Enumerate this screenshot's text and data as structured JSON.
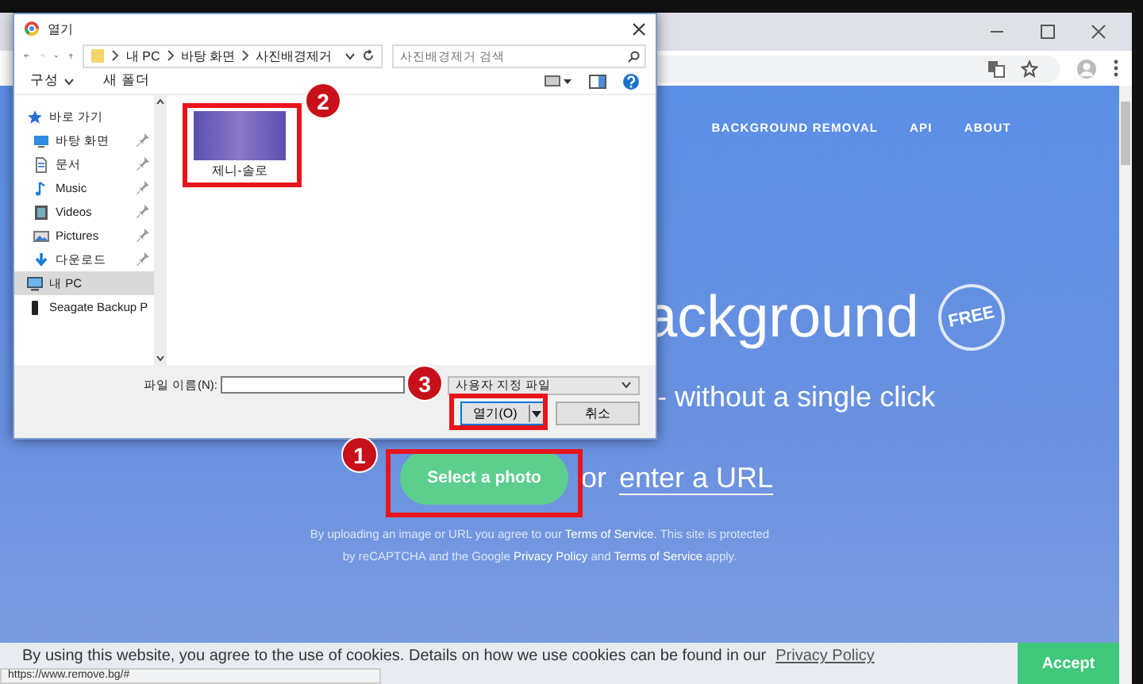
{
  "browser": {
    "nav": [
      "BACKGROUND REMOVAL",
      "API",
      "ABOUT"
    ],
    "headline": "ackground",
    "free_badge": "FREE",
    "subtitle": "- without a single click",
    "select_button": "Select a photo",
    "or_text": "or",
    "url_link": "enter a URL",
    "legal": [
      "By uploading an image or URL you agree to our **Terms of Service**. This site is protected",
      "by reCAPTCHA and the Google **Privacy Policy** and **Terms of Service** apply."
    ],
    "cookie": {
      "text": "By using this website, you agree to the use of cookies. Details on how we use cookies can be found in our",
      "link": "Privacy Policy",
      "button": "Accept"
    },
    "status_url": "https://www.remove.bg/#"
  },
  "dialog": {
    "title": "열기",
    "breadcrumb": [
      "내 PC",
      "바탕 화면",
      "사진배경제거"
    ],
    "search": {
      "placeholder": "사진배경제거 검색"
    },
    "toolbar": [
      "구성",
      "새 폴더"
    ],
    "sidebar": [
      {
        "label": "바로 가기",
        "kind": "star",
        "selected": false,
        "children": [
          {
            "label": "바탕 화면",
            "kind": "desktop",
            "pinned": true,
            "selected": false
          },
          {
            "label": "문서",
            "kind": "document",
            "pinned": true,
            "selected": false
          },
          {
            "label": "Music",
            "kind": "music",
            "pinned": true,
            "selected": false
          },
          {
            "label": "Videos",
            "kind": "video",
            "pinned": true,
            "selected": false
          },
          {
            "label": "Pictures",
            "kind": "picture",
            "pinned": true,
            "selected": false
          },
          {
            "label": "다운로드",
            "kind": "download",
            "pinned": true,
            "selected": false
          }
        ]
      },
      {
        "label": "내 PC",
        "kind": "pc",
        "selected": true
      },
      {
        "label": "Seagate Backup P",
        "kind": "drive",
        "selected": false
      }
    ],
    "files": [
      {
        "name": "제니-솔로"
      }
    ],
    "filename_label": "파일 이름(N):",
    "filetype": "사용자 지정 파일",
    "open_button": "열기(O)",
    "cancel_button": "취소"
  },
  "annotations": [
    {
      "label": "1"
    },
    {
      "label": "2"
    },
    {
      "label": "3"
    }
  ]
}
